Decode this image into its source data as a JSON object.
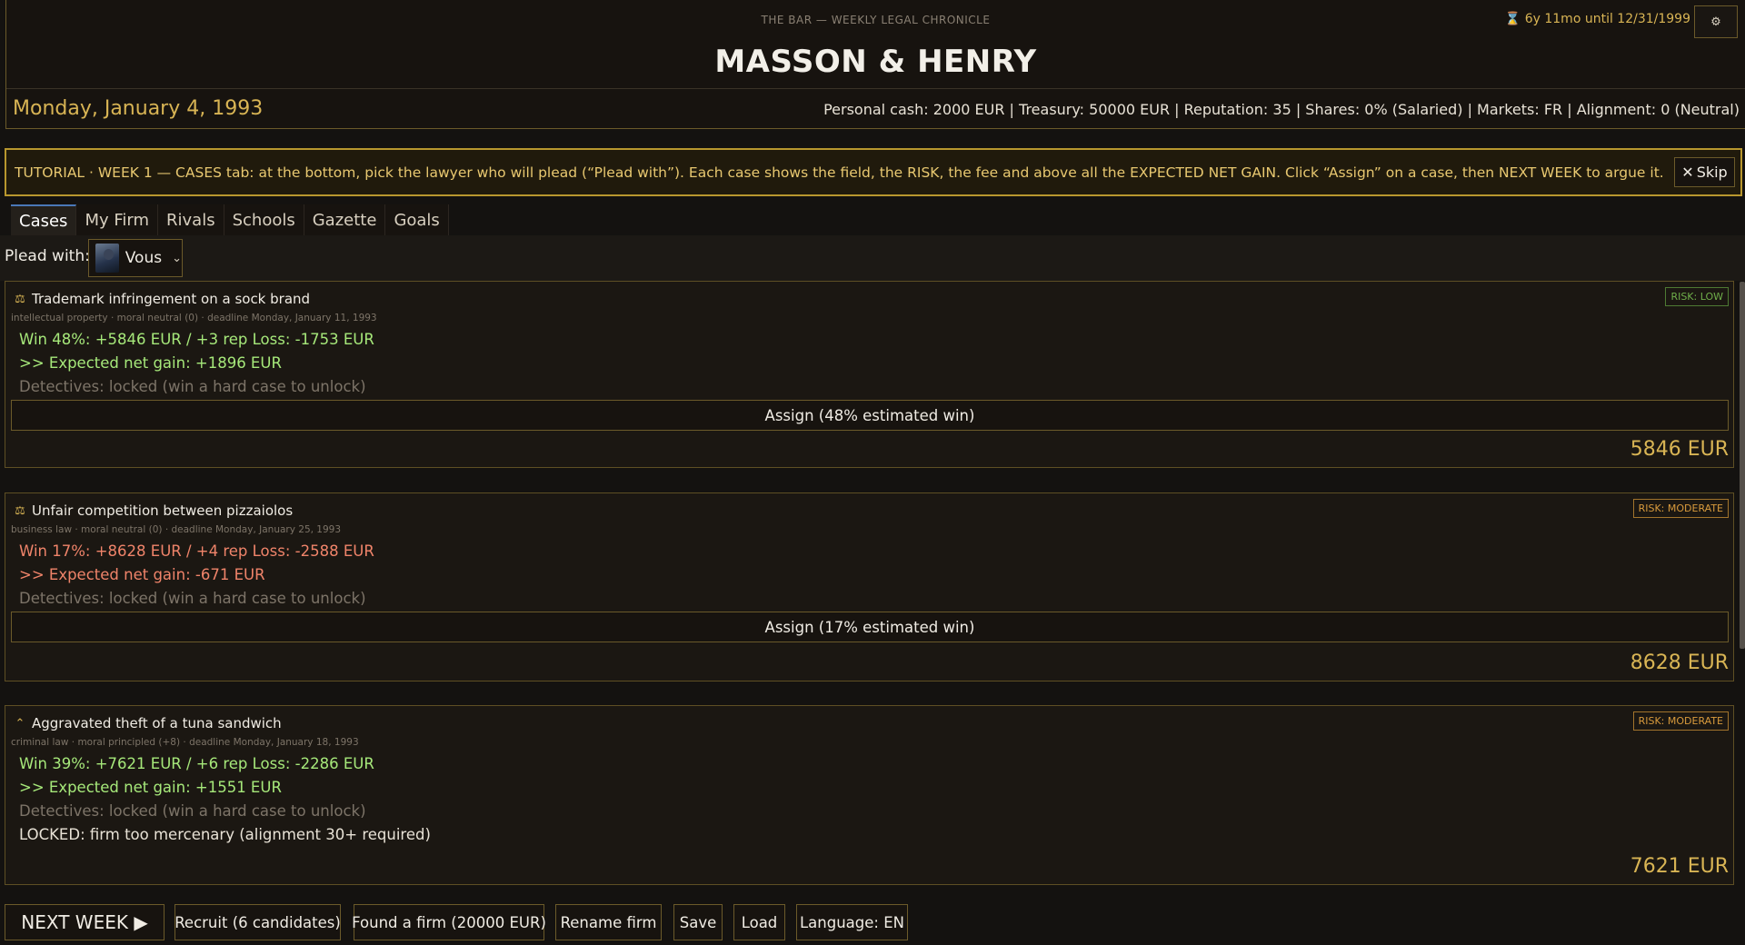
{
  "header": {
    "kicker": "THE BAR  —  WEEKLY LEGAL CHRONICLE",
    "countdown_icon": "hourglass-icon",
    "countdown": "⌛ 6y 11mo until 12/31/1999",
    "settings_icon": "⚙",
    "firm_name": "MASSON & HENRY",
    "date": "Monday, January 4, 1993",
    "stats": "Personal cash: 2000 EUR   |   Treasury: 50000 EUR   |   Reputation: 35   |   Shares: 0% (Salaried)   |   Markets: FR   |   Alignment: 0 (Neutral)"
  },
  "tutorial": {
    "text": "TUTORIAL · WEEK 1 — CASES tab: at the bottom, pick the lawyer who will plead (“Plead with”). Each case shows the field, the RISK, the fee and above all the EXPECTED NET GAIN. Click “Assign” on a case, then NEXT WEEK to argue it.",
    "skip_icon": "✕",
    "skip_label": "Skip"
  },
  "tabs": [
    "Cases",
    "My Firm",
    "Rivals",
    "Schools",
    "Gazette",
    "Goals"
  ],
  "plead": {
    "label": "Plead with:",
    "selected": "Vous"
  },
  "cases": [
    {
      "icon": "⚖",
      "title": "Trademark infringement on a sock brand",
      "meta": "intellectual property · moral neutral (0) · deadline Monday, January 11, 1993",
      "odds": "Win 48%: +5846 EUR / +3 rep   Loss: -1753 EUR",
      "gain": ">> Expected net gain: +1896 EUR",
      "detectives": "Detectives: locked (win a hard case to unlock)",
      "assign": "Assign (48% estimated win)",
      "fee": "5846 EUR",
      "risk": "RISK: LOW",
      "tone": "good"
    },
    {
      "icon": "⚖",
      "title": "Unfair competition between pizzaiolos",
      "meta": "business law · moral neutral (0) · deadline Monday, January 25, 1993",
      "odds": "Win 17%: +8628 EUR / +4 rep   Loss: -2588 EUR",
      "gain": ">> Expected net gain: -671 EUR",
      "detectives": "Detectives: locked (win a hard case to unlock)",
      "assign": "Assign (17% estimated win)",
      "fee": "8628 EUR",
      "risk": "RISK: MODERATE",
      "tone": "bad"
    },
    {
      "icon": "⌃",
      "title": "Aggravated theft of a tuna sandwich",
      "meta": "criminal law · moral principled (+8) · deadline Monday, January 18, 1993",
      "odds": "Win 39%: +7621 EUR / +6 rep   Loss: -2286 EUR",
      "gain": ">> Expected net gain: +1551 EUR",
      "detectives": "Detectives: locked (win a hard case to unlock)",
      "locked": "LOCKED: firm too mercenary (alignment 30+ required)",
      "fee": "7621 EUR",
      "risk": "RISK: MODERATE",
      "tone": "good"
    }
  ],
  "bottom": {
    "next_week": "NEXT WEEK  ▶",
    "recruit": "Recruit (6 candidates)",
    "found": "Found a firm (20000 EUR)",
    "rename": "Rename firm",
    "save": "Save",
    "load": "Load",
    "language": "Language: EN"
  },
  "colors": {
    "accent_gold": "#d8b454",
    "gain_positive": "#a6e87a",
    "gain_negative": "#f0846a",
    "risk_low": "#6fae4a",
    "risk_moderate": "#d89a3c"
  }
}
